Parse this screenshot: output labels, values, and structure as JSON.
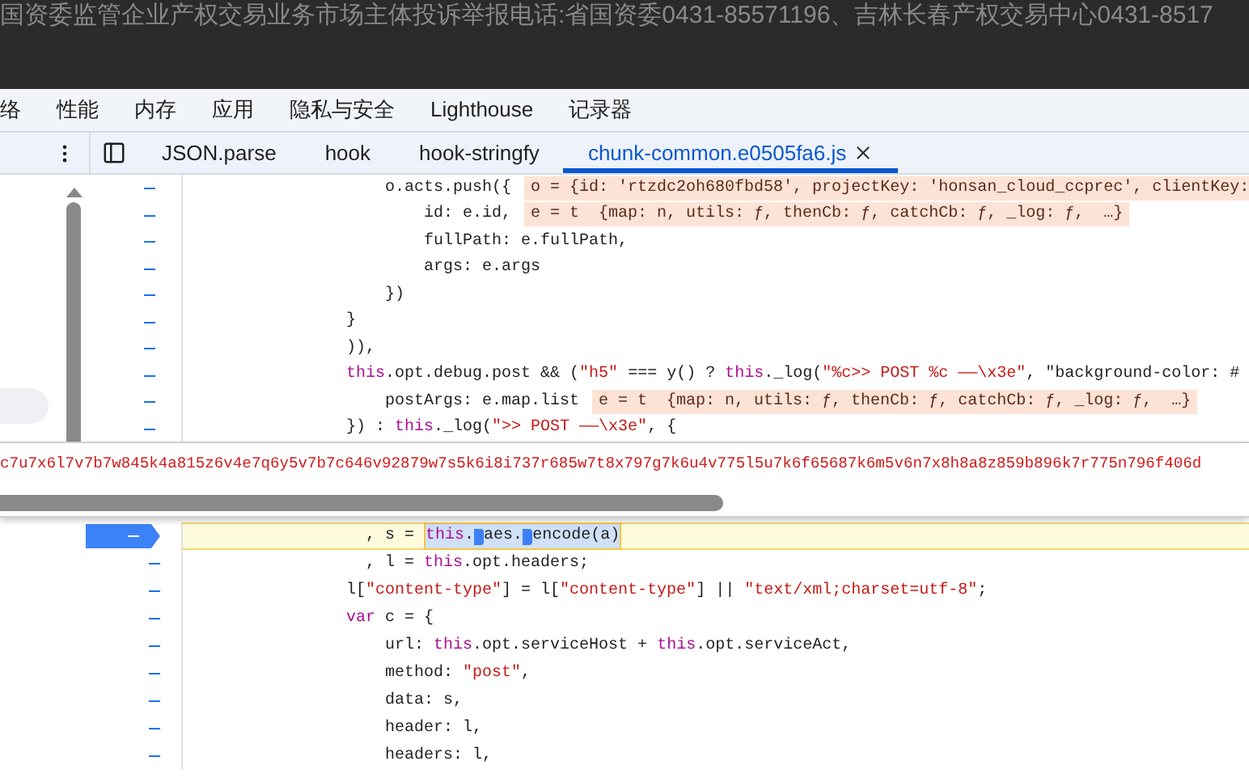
{
  "page_banner": {
    "text": "国资委监管企业产权交易业务市场主体投诉举报电话:省国资委0431-85571196、吉林长春产权交易中心0431-8517"
  },
  "devtools_tabs": [
    {
      "label": "络",
      "selected": false
    },
    {
      "label": "性能",
      "selected": false
    },
    {
      "label": "内存",
      "selected": false
    },
    {
      "label": "应用",
      "selected": false
    },
    {
      "label": "隐私与安全",
      "selected": false
    },
    {
      "label": "Lighthouse",
      "selected": false
    },
    {
      "label": "记录器",
      "selected": false
    }
  ],
  "editor_tabs": [
    {
      "label": "JSON.parse",
      "selected": false
    },
    {
      "label": "hook",
      "selected": false
    },
    {
      "label": "hook-stringfy",
      "selected": false
    },
    {
      "label": "chunk-common.e0505fa6.js",
      "selected": true
    }
  ],
  "code_lines_top": [
    {
      "text": "    o.acts.push({",
      "inline_value": "o = {id: 'rtzdc2oh680fbd58', projectKey: 'honsan_cloud_ccprec', clientKey:"
    },
    {
      "text": "        id: e.id,",
      "inline_value": "e = t  {map: n, utils: ƒ, thenCb: ƒ, catchCb: ƒ, _log: ƒ,  …}"
    },
    {
      "text": "        fullPath: e.fullPath,"
    },
    {
      "text": "        args: e.args"
    },
    {
      "text": "    })"
    },
    {
      "text": "}"
    },
    {
      "text": ")),"
    },
    {
      "text": "this.opt.debug.post && (\"h5\" === y() ? this._log(\"%c>> POST %c ——\\x3e\", \"background-color: #"
    },
    {
      "text": "    postArgs: e.map.list",
      "inline_value": "e = t  {map: n, utils: ƒ, thenCb: ƒ, catchCb: ƒ, _log: ƒ,  …}"
    },
    {
      "text": "}) : this._log(\">> POST ——\\x3e\", {"
    }
  ],
  "value_popover": {
    "text": "c7u7x6l7v7b7w845k4a815z6v4e7q6y5v7b7c646v92879w7s5k6i8i737r685w7t8x797g7k6u4v775l5u7k6f65687k6m5v6n7x8h8a8z859b896k7r775n796f406d"
  },
  "code_lines_bottom": [
    {
      "text": "  , s = ",
      "selection": [
        "this.",
        "aes.",
        "encode(a)"
      ],
      "paused": true
    },
    {
      "text": "  , l = this.opt.headers;",
      "paused": false
    },
    {
      "text": "l[\"content-type\"] = l[\"content-type\"] || \"text/xml;charset=utf-8\";",
      "paused": false
    },
    {
      "text": "var c = {",
      "paused": false
    },
    {
      "text": "    url: this.opt.serviceHost + this.opt.serviceAct,",
      "paused": false
    },
    {
      "text": "    method: \"post\",",
      "paused": false
    },
    {
      "text": "    data: s,",
      "paused": false
    },
    {
      "text": "    header: l,",
      "paused": false
    },
    {
      "text": "    headers: l,",
      "paused": false
    }
  ]
}
